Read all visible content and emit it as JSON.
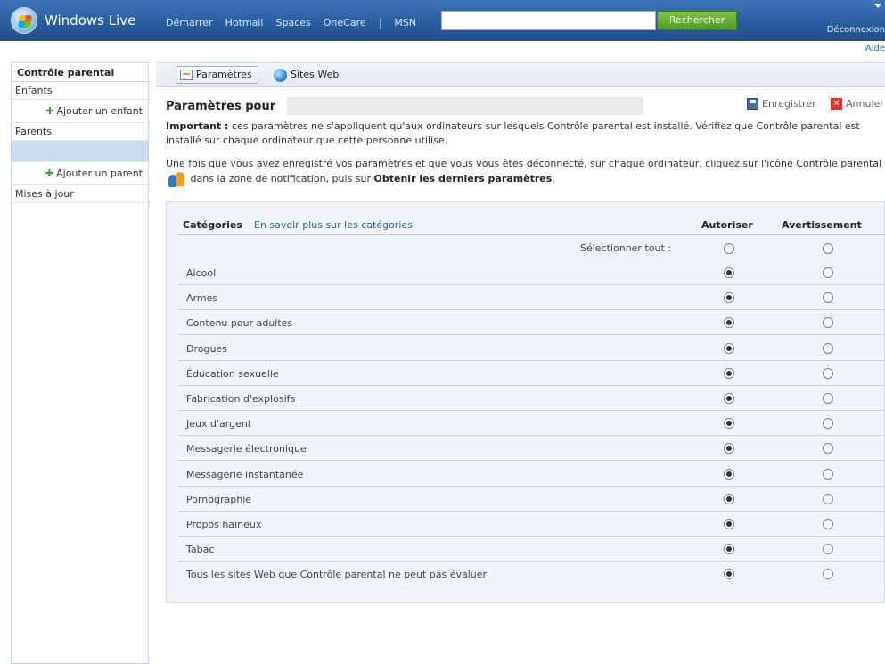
{
  "header": {
    "logo_text": "Windows Live",
    "nav": [
      "Démarrer",
      "Hotmail",
      "Spaces",
      "OneCare",
      "MSN"
    ],
    "search_button": "Rechercher",
    "signout": "Déconnexion",
    "help": "Aide"
  },
  "sidebar": {
    "title": "Contrôle parental",
    "children_label": "Enfants",
    "add_child": "Ajouter un enfant",
    "parents_label": "Parents",
    "add_parent": "Ajouter un parent",
    "updates": "Mises à jour"
  },
  "tabs": {
    "params": "Paramètres",
    "sites": "Sites Web"
  },
  "content": {
    "title": "Paramètres pour",
    "save": "Enregistrer",
    "cancel": "Annuler",
    "important_label": "Important :",
    "important_text": " ces paramètres ne s'appliquent qu'aux ordinateurs sur lesquels Contrôle parental est installé. Vérifiez que Contrôle parental est installé sur chaque ordinateur que cette personne utilise.",
    "intro_a": "Une fois que vous avez enregistré vos paramètres et que vous vous êtes déconnecté, sur chaque ordinateur, cliquez sur l'icône Contrôle parental",
    "intro_b": "dans la zone de notification, puis sur",
    "intro_bold": "Obtenir les derniers paramètres",
    "intro_end": "."
  },
  "table": {
    "col_categories": "Catégories",
    "learn_more": "En savoir plus sur les catégories",
    "col_allow": "Autoriser",
    "col_warn": "Avertissement",
    "select_all": "Sélectionner tout :",
    "rows": [
      {
        "label": "Alcool",
        "allow": true
      },
      {
        "label": "Armes",
        "allow": true
      },
      {
        "label": "Contenu pour adultes",
        "allow": true
      },
      {
        "label": "Drogues",
        "allow": true
      },
      {
        "label": "Éducation sexuelle",
        "allow": true
      },
      {
        "label": "Fabrication d'explosifs",
        "allow": true
      },
      {
        "label": "Jeux d'argent",
        "allow": true
      },
      {
        "label": "Messagerie électronique",
        "allow": true
      },
      {
        "label": "Messagerie instantanée",
        "allow": true
      },
      {
        "label": "Pornographie",
        "allow": true
      },
      {
        "label": "Propos haineux",
        "allow": true
      },
      {
        "label": "Tabac",
        "allow": true
      },
      {
        "label": "Tous les sites Web que Contrôle parental ne peut pas évaluer",
        "allow": true
      }
    ]
  }
}
